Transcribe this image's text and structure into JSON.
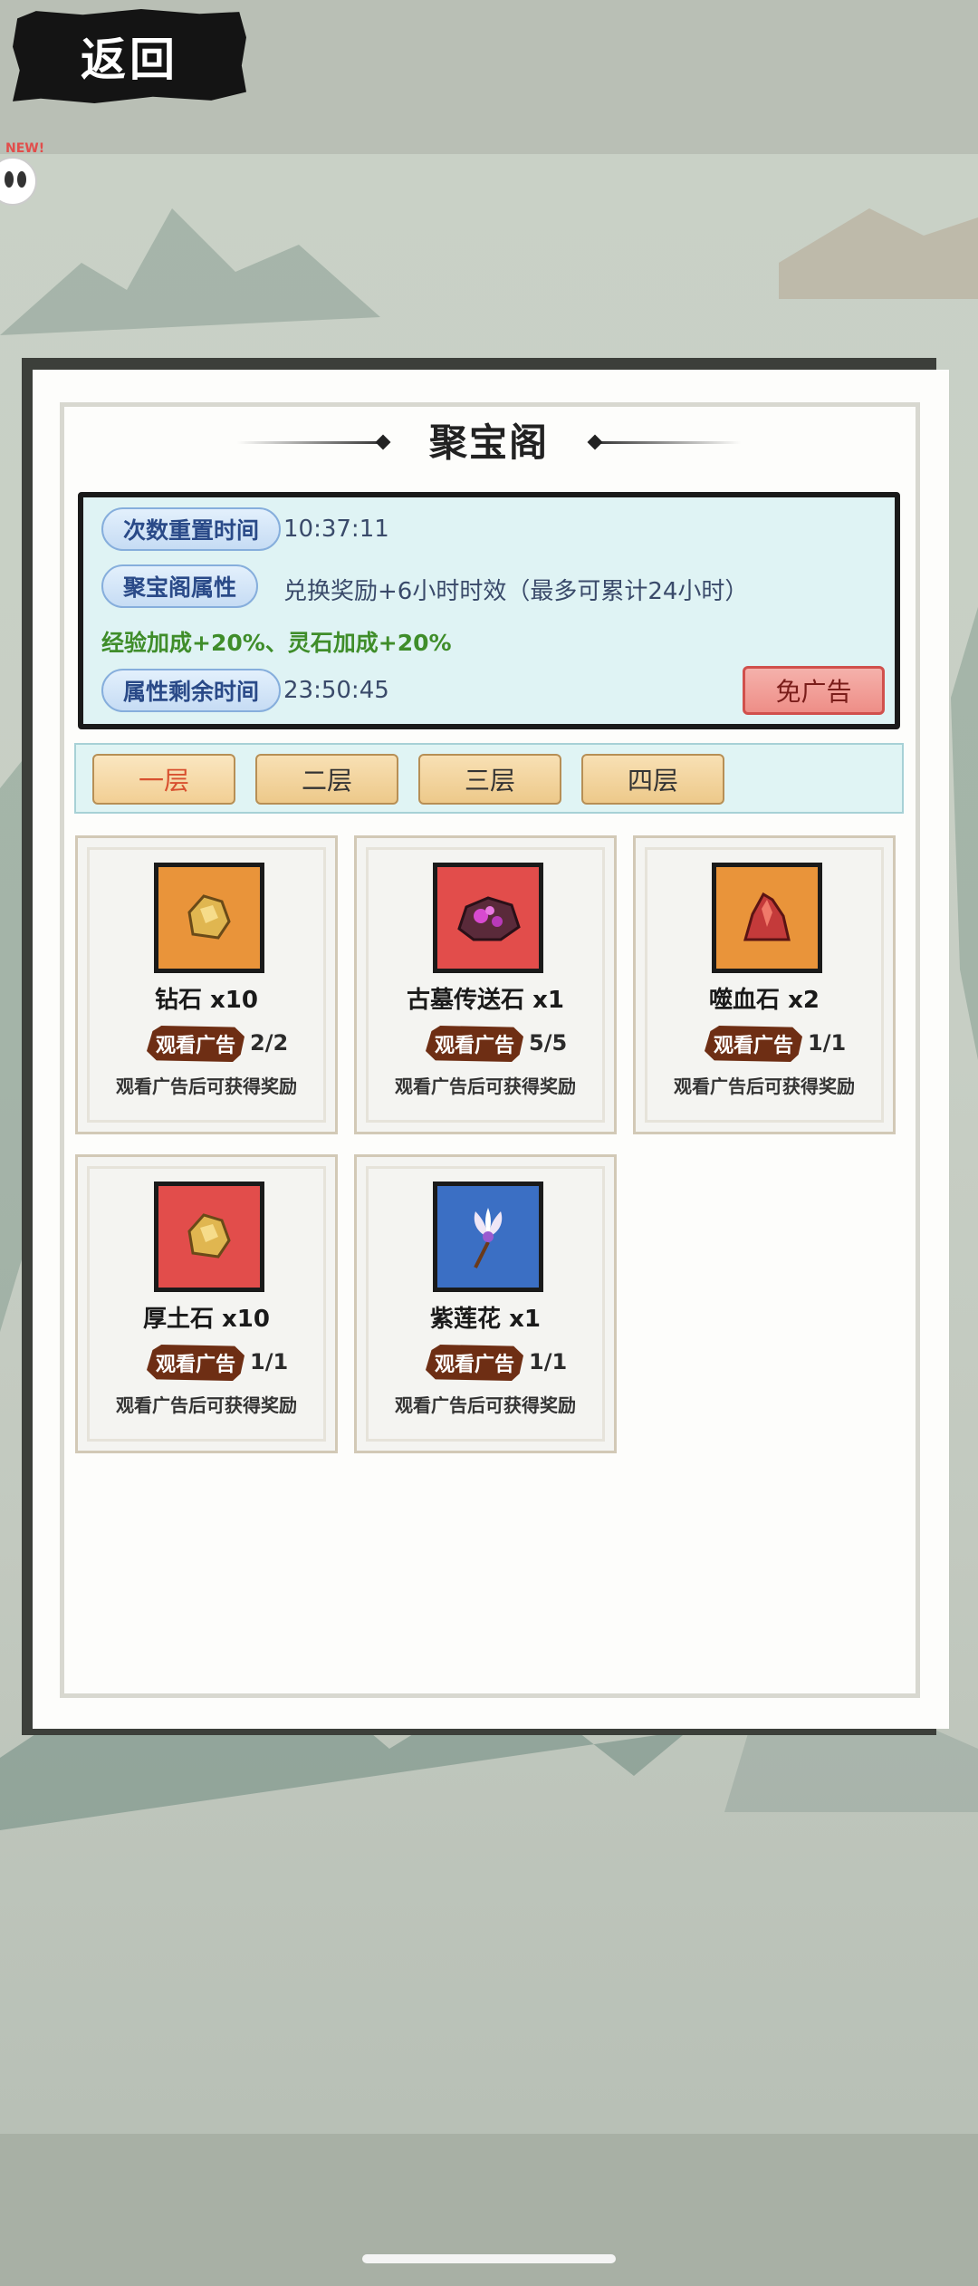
{
  "back_label": "返回",
  "new_badge": "NEW!",
  "title": "聚宝阁",
  "info": {
    "reset_label": "次数重置时间",
    "reset_value": "10:37:11",
    "attr_label": "聚宝阁属性",
    "attr_value": "兑换奖励+6小时时效（最多可累计24小时）",
    "bonus_text": "经验加成+20%、灵石加成+20%",
    "remain_label": "属性剩余时间",
    "remain_value": "23:50:45",
    "no_ad_label": "免广告"
  },
  "floors": [
    "一层",
    "二层",
    "三层",
    "四层"
  ],
  "active_floor": 0,
  "items": [
    {
      "name": "钻石 x10",
      "ad_label": "观看广告",
      "count": "2/2",
      "note": "观看广告后可获得奖励",
      "bg": "#e9943a",
      "icon": "gold-nugget-icon"
    },
    {
      "name": "古墓传送石 x1",
      "ad_label": "观看广告",
      "count": "5/5",
      "note": "观看广告后可获得奖励",
      "bg": "#e24d4b",
      "icon": "purple-ore-icon"
    },
    {
      "name": "噬血石 x2",
      "ad_label": "观看广告",
      "count": "1/1",
      "note": "观看广告后可获得奖励",
      "bg": "#e9943a",
      "icon": "red-crystal-icon"
    },
    {
      "name": "厚土石 x10",
      "ad_label": "观看广告",
      "count": "1/1",
      "note": "观看广告后可获得奖励",
      "bg": "#e24d4b",
      "icon": "gold-nugget-icon"
    },
    {
      "name": "紫莲花 x1",
      "ad_label": "观看广告",
      "count": "1/1",
      "note": "观看广告后可获得奖励",
      "bg": "#3b6fc4",
      "icon": "lotus-flower-icon"
    }
  ]
}
